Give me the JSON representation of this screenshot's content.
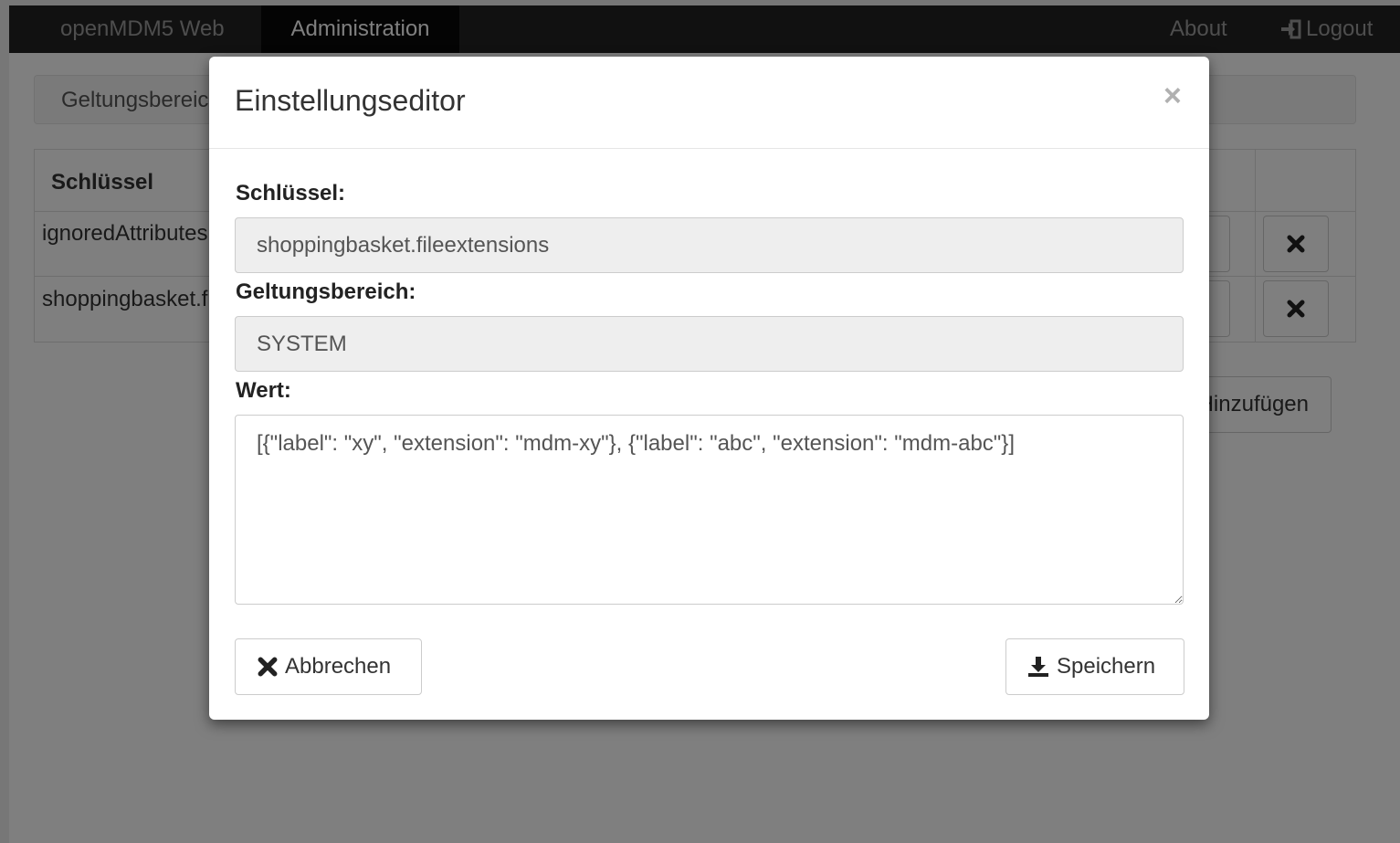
{
  "navbar": {
    "brand": "openMDM5 Web",
    "active_tab": "Administration",
    "about": "About",
    "logout": "Logout"
  },
  "background": {
    "scope_label": "Geltungsbereich",
    "table_header_key": "Schlüssel",
    "rows": [
      {
        "key": "ignoredAttributes"
      },
      {
        "key": "shoppingbasket.fileextensions"
      }
    ],
    "add_button": "Hinzufügen"
  },
  "modal": {
    "title": "Einstellungseditor",
    "close": "×",
    "key_label": "Schlüssel:",
    "key_value": "shoppingbasket.fileextensions",
    "scope_label": "Geltungsbereich:",
    "scope_value": "SYSTEM",
    "value_label": "Wert:",
    "value_text": "[{\"label\": \"xy\", \"extension\": \"mdm-xy\"}, {\"label\": \"abc\", \"extension\": \"mdm-abc\"}]",
    "cancel_button": "Abbrechen",
    "save_button": "Speichern"
  },
  "icons": {
    "delete": "remove-icon",
    "cancel": "remove-icon",
    "save": "download-icon",
    "logout": "log-in-icon"
  }
}
